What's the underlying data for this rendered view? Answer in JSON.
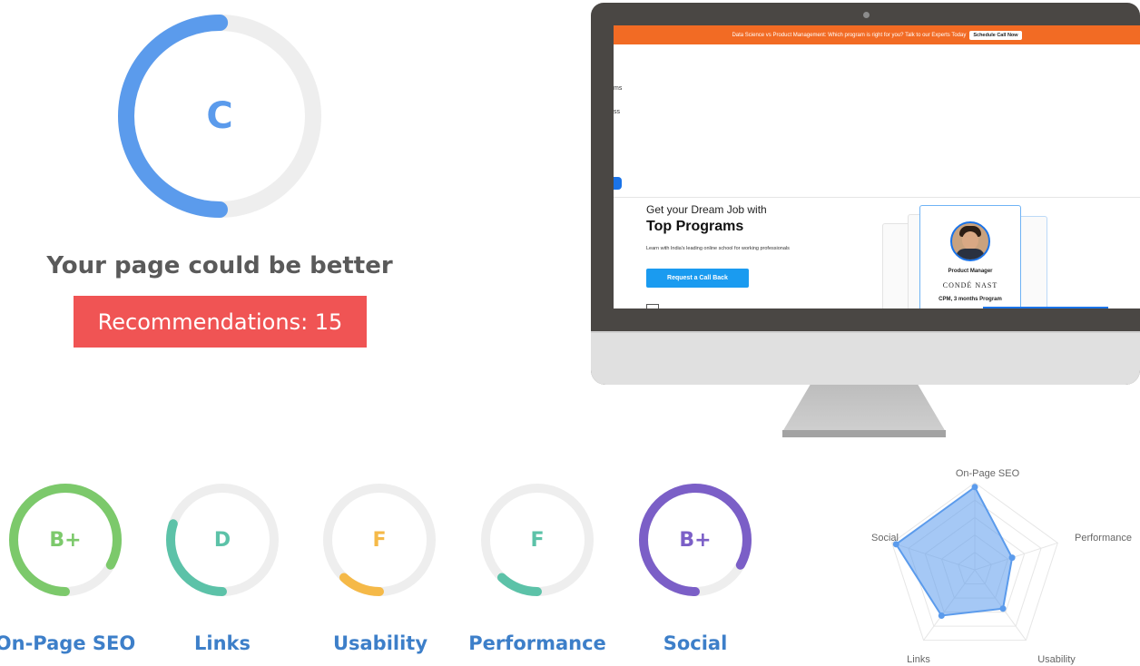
{
  "overall": {
    "grade": "C",
    "score": 0.5,
    "color": "#5b9bec",
    "verdict": "Your page could be better",
    "recommendations": "Recommendations: 15"
  },
  "preview": {
    "promo_text": "Data Science vs Product Management: Which program is right for you? Talk to our Experts Today",
    "promo_cta": "Schedule Call Now",
    "nav_fragments": [
      "ms",
      "ss"
    ],
    "hero_subtitle": "Get your Dream Job with",
    "hero_title": "Top Programs",
    "hero_desc": "Learn with India's leading online school for working professionals",
    "hero_button": "Request a Call Back",
    "card_role": "Product Manager",
    "card_company": "CONDÉ NAST",
    "card_program": "CPM, 3 months Program"
  },
  "categories": [
    {
      "label": "On-Page SEO",
      "grade": "B+",
      "score": 0.83,
      "color": "#7cc96b"
    },
    {
      "label": "Links",
      "grade": "D",
      "score": 0.3,
      "color": "#5cc2a8"
    },
    {
      "label": "Usability",
      "grade": "F",
      "score": 0.12,
      "color": "#f5b948"
    },
    {
      "label": "Performance",
      "grade": "F",
      "score": 0.12,
      "color": "#5cc2a8"
    },
    {
      "label": "Social",
      "grade": "B+",
      "score": 0.83,
      "color": "#7b5fc7"
    }
  ],
  "radar": {
    "axes": [
      "On-Page SEO",
      "Performance",
      "Usability",
      "Links",
      "Social"
    ],
    "values": [
      0.95,
      0.45,
      0.55,
      0.65,
      0.95
    ],
    "fill": "#5b9bec"
  }
}
